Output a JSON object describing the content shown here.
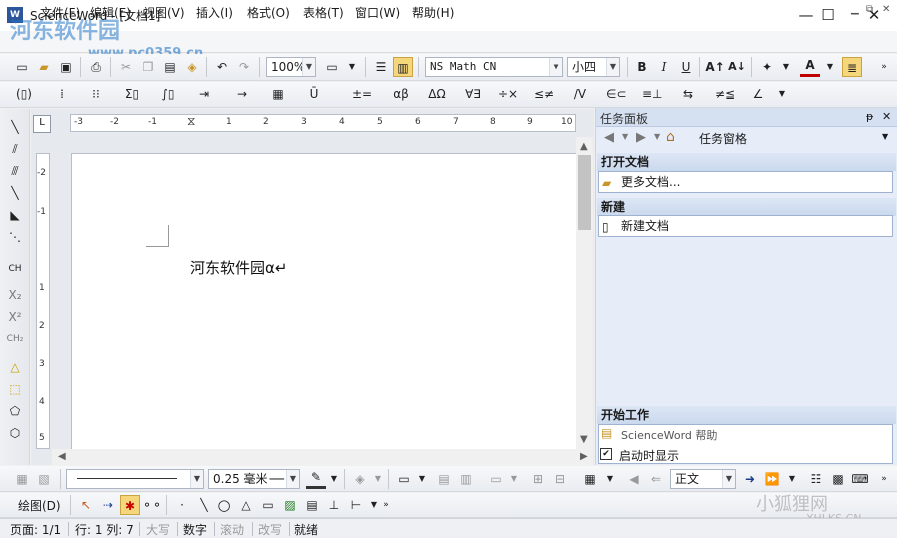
{
  "window": {
    "title": "ScienceWord - [文档1]",
    "icon_glyph": "W",
    "controls": {
      "minimize": "—",
      "maximize": "☐",
      "close": "✕"
    }
  },
  "watermark": {
    "site": "河东软件园",
    "url": "www.pc0359.cn",
    "brand": "小狐狸网",
    "brand_url": "XHLKS.CN"
  },
  "menu": {
    "items": [
      "文件(F)",
      "编辑(E)",
      "视图(V)",
      "插入(I)",
      "格式(O)",
      "表格(T)",
      "窗口(W)",
      "帮助(H)"
    ],
    "mdi_controls": [
      "▁",
      "⧉",
      "✕"
    ]
  },
  "toolbar1": {
    "zoom": "100%",
    "font": "NS Math CN",
    "font_size": "小四",
    "bold": "B",
    "italic": "I",
    "underline": "U",
    "font_color_glyph": "A"
  },
  "toolbar2": {
    "labels": [
      "αβ",
      "ΔΩ",
      "∀∃",
      "≠≦",
      "∠"
    ]
  },
  "ruler": {
    "h_ticks": [
      "-3",
      "-2",
      "-1",
      "1",
      "2",
      "3",
      "4",
      "5",
      "6",
      "7",
      "8",
      "9",
      "10"
    ],
    "v_ticks": [
      "-2",
      "-1",
      "1",
      "2",
      "3",
      "4",
      "5"
    ],
    "corner": "L"
  },
  "lefttools": {
    "ch": "CH",
    "x_sub": "X₂",
    "x_sup": "X²",
    "ch_sub": "CH₂"
  },
  "document": {
    "text": "河东软件园α↵"
  },
  "taskpane": {
    "title": "任务面板",
    "pin": "ᵽ",
    "close": "✕",
    "nav_label": "任务窗格",
    "open_section": "打开文档",
    "open_more": "更多文档...",
    "new_section": "新建",
    "new_doc": "新建文档",
    "start_section": "开始工作",
    "help": "ScienceWord 帮助",
    "show_on_start": "启动时显示",
    "show_on_start_checked": "✔"
  },
  "toolbar3": {
    "line_width": "0.25 毫米",
    "style": "正文"
  },
  "toolbar4": {
    "draw_label": "绘图(D)"
  },
  "status": {
    "page": "页面: 1/1",
    "rowcol": "行: 1 列: 7",
    "caps": "大写",
    "num": "数字",
    "scroll": "滚动",
    "ovr": "改写",
    "ready": "就绪"
  }
}
